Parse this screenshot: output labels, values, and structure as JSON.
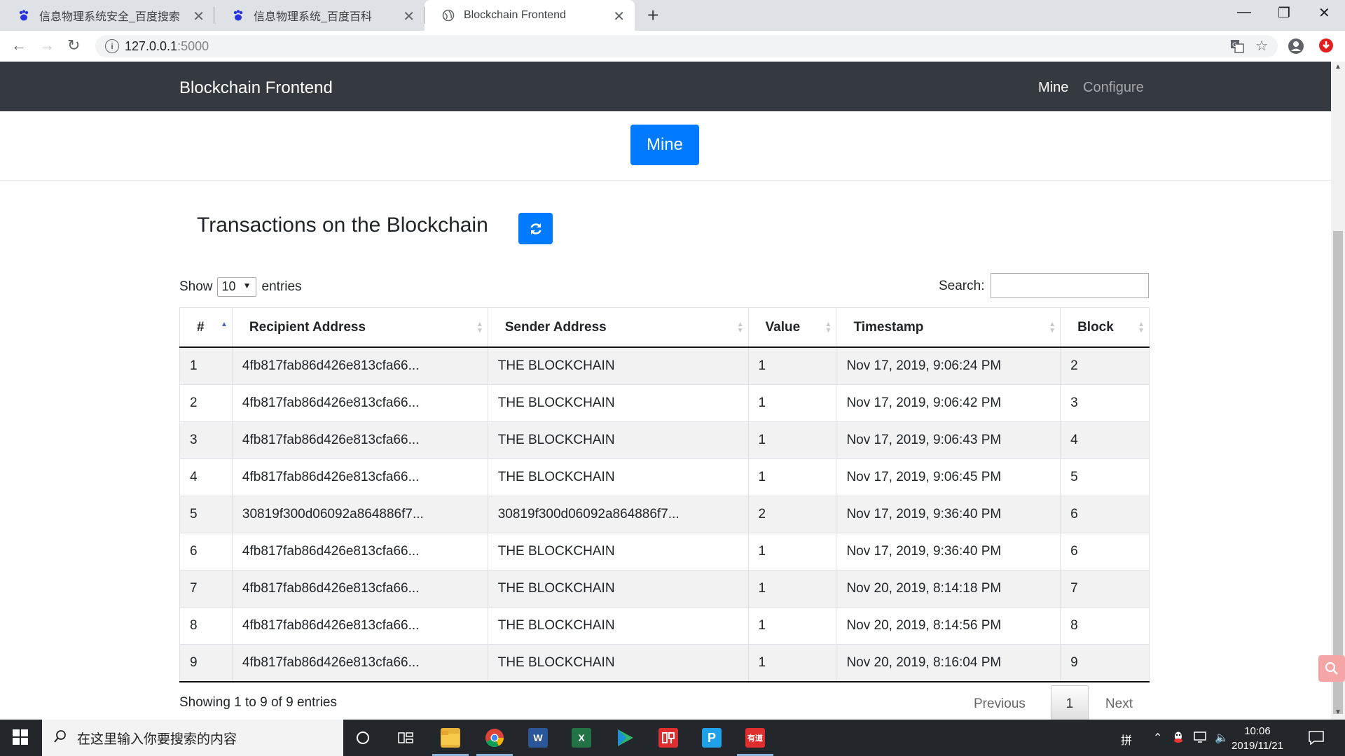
{
  "browser": {
    "tabs": [
      {
        "title": "信息物理系统安全_百度搜索",
        "icon": "baidu-paw-icon"
      },
      {
        "title": "信息物理系统_百度百科",
        "icon": "baidu-paw-icon"
      },
      {
        "title": "Blockchain Frontend",
        "icon": "globe-icon",
        "active": true
      }
    ],
    "url_host": "127.0.0.1",
    "url_port": ":5000"
  },
  "navbar": {
    "brand": "Blockchain Frontend",
    "links": [
      "Mine",
      "Configure"
    ]
  },
  "mine_button": "Mine",
  "section_title": "Transactions on the Blockchain",
  "table_controls": {
    "show_label": "Show",
    "entries_select": "10",
    "entries_label": "entries",
    "search_label": "Search:"
  },
  "table": {
    "headers": [
      "#",
      "Recipient Address",
      "Sender Address",
      "Value",
      "Timestamp",
      "Block"
    ],
    "rows": [
      [
        "1",
        "4fb817fab86d426e813cfa66...",
        "THE BLOCKCHAIN",
        "1",
        "Nov 17, 2019, 9:06:24 PM",
        "2"
      ],
      [
        "2",
        "4fb817fab86d426e813cfa66...",
        "THE BLOCKCHAIN",
        "1",
        "Nov 17, 2019, 9:06:42 PM",
        "3"
      ],
      [
        "3",
        "4fb817fab86d426e813cfa66...",
        "THE BLOCKCHAIN",
        "1",
        "Nov 17, 2019, 9:06:43 PM",
        "4"
      ],
      [
        "4",
        "4fb817fab86d426e813cfa66...",
        "THE BLOCKCHAIN",
        "1",
        "Nov 17, 2019, 9:06:45 PM",
        "5"
      ],
      [
        "5",
        "30819f300d06092a864886f7...",
        "30819f300d06092a864886f7...",
        "2",
        "Nov 17, 2019, 9:36:40 PM",
        "6"
      ],
      [
        "6",
        "4fb817fab86d426e813cfa66...",
        "THE BLOCKCHAIN",
        "1",
        "Nov 17, 2019, 9:36:40 PM",
        "6"
      ],
      [
        "7",
        "4fb817fab86d426e813cfa66...",
        "THE BLOCKCHAIN",
        "1",
        "Nov 20, 2019, 8:14:18 PM",
        "7"
      ],
      [
        "8",
        "4fb817fab86d426e813cfa66...",
        "THE BLOCKCHAIN",
        "1",
        "Nov 20, 2019, 8:14:56 PM",
        "8"
      ],
      [
        "9",
        "4fb817fab86d426e813cfa66...",
        "THE BLOCKCHAIN",
        "1",
        "Nov 20, 2019, 8:16:04 PM",
        "9"
      ]
    ]
  },
  "table_info": "Showing 1 to 9 of 9 entries",
  "pagination": {
    "previous": "Previous",
    "current": "1",
    "next": "Next"
  },
  "taskbar": {
    "search_placeholder": "在这里输入你要搜索的内容",
    "apps": [
      "file-explorer-icon",
      "chrome-icon",
      "word-icon",
      "excel-icon",
      "media-player-icon",
      "youdao-icon",
      "wps-pdf-icon",
      "netease-youdao-icon"
    ],
    "ime": "拼",
    "app_label_youdao": "有道",
    "time": "10:06",
    "date": "2019/11/21"
  },
  "colors": {
    "primary": "#007bff",
    "navbar": "#343a40",
    "taskbar": "#23262b"
  }
}
